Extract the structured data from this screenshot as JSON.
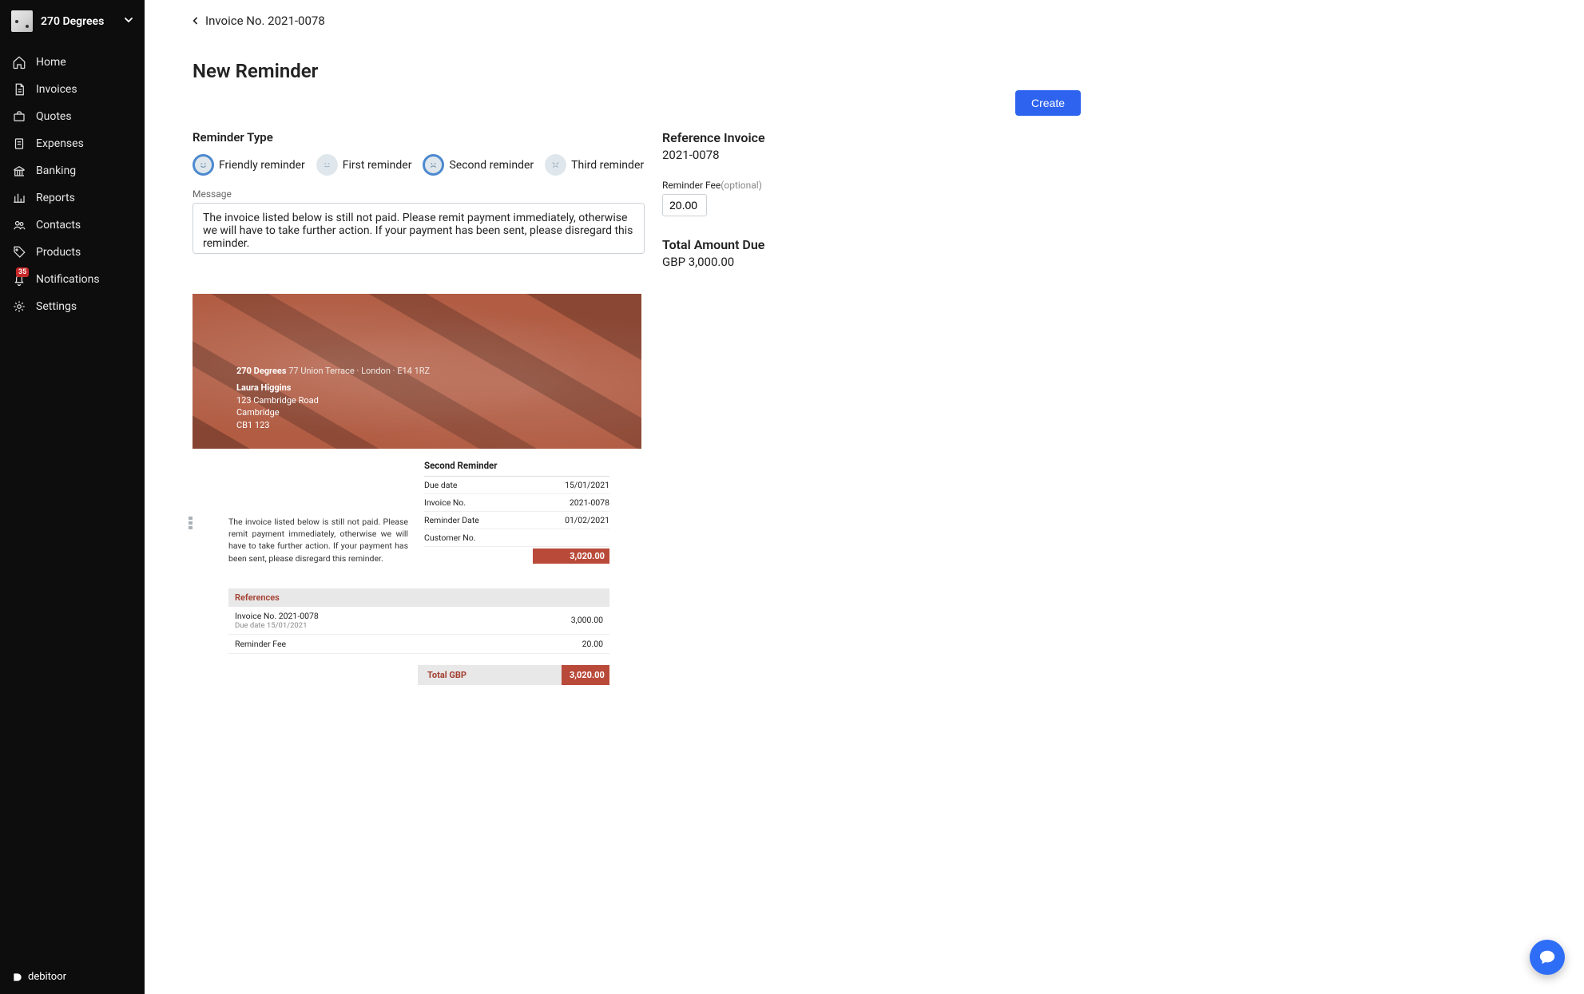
{
  "company": {
    "name": "270 Degrees"
  },
  "sidebar": {
    "items": [
      {
        "id": "home",
        "label": "Home"
      },
      {
        "id": "invoices",
        "label": "Invoices"
      },
      {
        "id": "quotes",
        "label": "Quotes"
      },
      {
        "id": "expenses",
        "label": "Expenses"
      },
      {
        "id": "banking",
        "label": "Banking"
      },
      {
        "id": "reports",
        "label": "Reports"
      },
      {
        "id": "contacts",
        "label": "Contacts"
      },
      {
        "id": "products",
        "label": "Products"
      },
      {
        "id": "notifications",
        "label": "Notifications",
        "badge": "35"
      },
      {
        "id": "settings",
        "label": "Settings"
      }
    ],
    "footer_brand": "debitoor"
  },
  "breadcrumb": {
    "label": "Invoice No. 2021-0078"
  },
  "page": {
    "title": "New Reminder",
    "create_button": "Create"
  },
  "reminder_type": {
    "section_label": "Reminder Type",
    "options": [
      {
        "id": "friendly",
        "label": "Friendly reminder",
        "selected": true
      },
      {
        "id": "first",
        "label": "First reminder",
        "selected": false
      },
      {
        "id": "second",
        "label": "Second reminder",
        "selected": true
      },
      {
        "id": "third",
        "label": "Third reminder",
        "selected": false
      }
    ]
  },
  "message": {
    "label": "Message",
    "value": "The invoice listed below is still not paid. Please remit payment immediately, otherwise we will have to take further action. If your payment has been sent, please disregard this reminder."
  },
  "reference": {
    "title": "Reference Invoice",
    "value": "2021-0078",
    "fee_label": "Reminder Fee",
    "fee_optional": "(optional)",
    "fee_value": "20.00",
    "total_title": "Total Amount Due",
    "total_value": "GBP 3,000.00"
  },
  "preview": {
    "company": "270 Degrees",
    "company_addr": "77 Union Terrace · London · E14 1RZ",
    "recipient": {
      "name": "Laura Higgins",
      "line1": "123 Cambridge Road",
      "line2": "Cambridge",
      "line3": "CB1 123"
    },
    "doc_title": "Second Reminder",
    "rows": [
      {
        "label": "Due date",
        "value": "15/01/2021"
      },
      {
        "label": "Invoice No.",
        "value": "2021-0078"
      },
      {
        "label": "Reminder Date",
        "value": "01/02/2021"
      },
      {
        "label": "Customer No.",
        "value": ""
      }
    ],
    "reminder_amount": "3,020.00",
    "body_message": "The invoice listed below is still not paid. Please remit payment immediately, otherwise we will have to take further action. If your payment has been sent, please disregard this reminder.",
    "references_label": "References",
    "ref_items": [
      {
        "title": "Invoice No. 2021-0078",
        "sub": "Due date 15/01/2021",
        "amount": "3,000.00"
      },
      {
        "title": "Reminder Fee",
        "sub": "",
        "amount": "20.00"
      }
    ],
    "grand_label": "Total GBP",
    "grand_amount": "3,020.00"
  }
}
